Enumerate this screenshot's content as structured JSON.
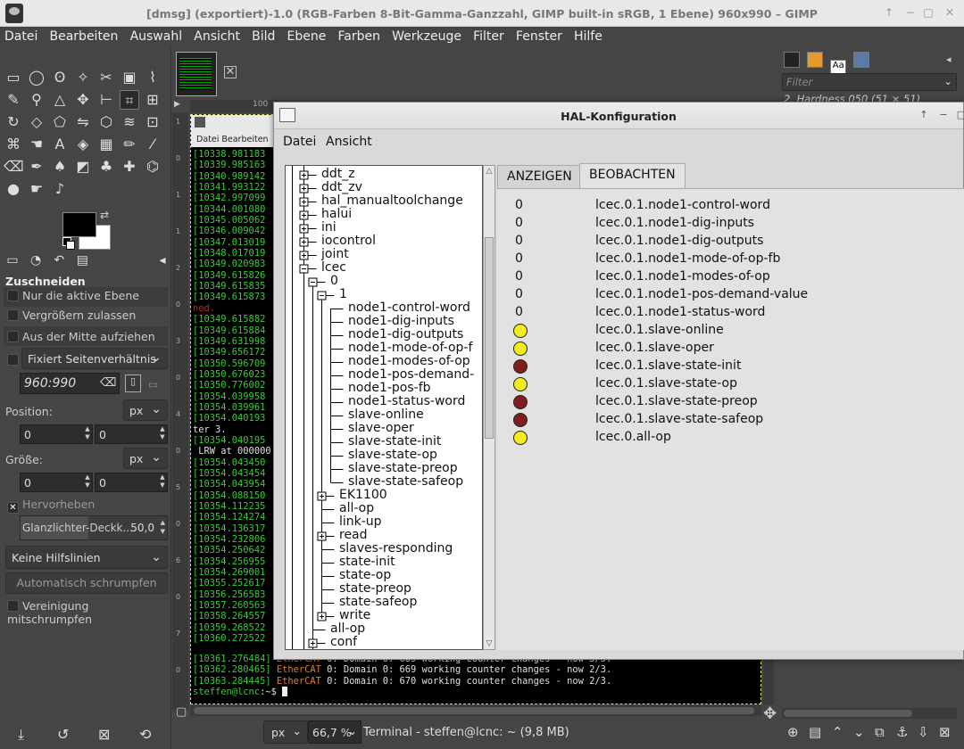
{
  "gimp": {
    "title": "[dmsg] (exportiert)-1.0 (RGB-Farben 8-Bit-Gamma-Ganzzahl, GIMP built-in sRGB, 1 Ebene) 960x990 – GIMP",
    "menu": [
      "Datei",
      "Bearbeiten",
      "Auswahl",
      "Ansicht",
      "Bild",
      "Ebene",
      "Farben",
      "Werkzeuge",
      "Filter",
      "Fenster",
      "Hilfe"
    ],
    "window_buttons": [
      "↑",
      "−",
      "□",
      "✕"
    ]
  },
  "toolbox": {
    "options_title": "Zuschneiden",
    "only_active_layer": "Nur die aktive Ebene",
    "allow_grow": "Vergrößern zulassen",
    "from_center": "Aus der Mitte aufziehen",
    "fixed_ratio": "Fixiert  Seitenverhältnis",
    "ratio_value": "960:990",
    "position_label": "Position:",
    "size_label": "Größe:",
    "unit": "px",
    "pos_x": "0",
    "pos_y": "0",
    "size_w": "0",
    "size_h": "0",
    "highlight_label": "Hervorheben",
    "highlight_opacity_label": "Glanzlichter-Deckk...",
    "highlight_opacity_value": "50,0",
    "guides": "Keine Hilfslinien",
    "auto_shrink": "Automatisch schrumpfen",
    "shrink_merged": "Vereinigung mitschrumpfen"
  },
  "image": {
    "ruler_mark": "100",
    "ruler_v": [
      "1",
      "0",
      "1",
      "1",
      "2",
      "0",
      "3",
      "0",
      "4",
      "0",
      "5",
      "0",
      "6",
      "0",
      "7",
      "0"
    ],
    "terminal_menu": "Datei   Bearbeiten",
    "terminal_lines": [
      {
        "c": "g",
        "t": "[10338.981183"
      },
      {
        "c": "g",
        "t": "[10339.985163"
      },
      {
        "c": "g",
        "t": "[10340.989142"
      },
      {
        "c": "g",
        "t": "[10341.993122"
      },
      {
        "c": "g",
        "t": "[10342.997099"
      },
      {
        "c": "g",
        "t": "[10344.001080"
      },
      {
        "c": "g",
        "t": "[10345.005062"
      },
      {
        "c": "g",
        "t": "[10346.009042"
      },
      {
        "c": "g",
        "t": "[10347.013019"
      },
      {
        "c": "g",
        "t": "[10348.017019"
      },
      {
        "c": "g",
        "t": "[10349.020983"
      },
      {
        "c": "g",
        "t": "[10349.615826"
      },
      {
        "c": "g",
        "t": "[10349.615835"
      },
      {
        "c": "g",
        "t": "[10349.615873"
      },
      {
        "c": "r",
        "t": "ned."
      },
      {
        "c": "g",
        "t": "[10349.615882"
      },
      {
        "c": "g",
        "t": "[10349.615884"
      },
      {
        "c": "g",
        "t": "[10349.631998"
      },
      {
        "c": "g",
        "t": "[10349.656172"
      },
      {
        "c": "g",
        "t": "[10350.596709"
      },
      {
        "c": "g",
        "t": "[10350.676023"
      },
      {
        "c": "g",
        "t": "[10350.776002"
      },
      {
        "c": "g",
        "t": "[10354.039958"
      },
      {
        "c": "g",
        "t": "[10354.039961"
      },
      {
        "c": "g",
        "t": "[10354.040193"
      },
      {
        "c": "w",
        "t": "ter 3."
      },
      {
        "c": "g",
        "t": "[10354.040195"
      },
      {
        "c": "w",
        "t": " LRW at 000000"
      },
      {
        "c": "g",
        "t": "[10354.043450"
      },
      {
        "c": "g",
        "t": "[10354.043454"
      },
      {
        "c": "g",
        "t": "[10354.043954"
      },
      {
        "c": "g",
        "t": "[10354.088150"
      },
      {
        "c": "g",
        "t": "[10354.112235"
      },
      {
        "c": "g",
        "t": "[10354.124274"
      },
      {
        "c": "g",
        "t": "[10354.136317"
      },
      {
        "c": "g",
        "t": "[10354.232806"
      },
      {
        "c": "g",
        "t": "[10354.250642"
      },
      {
        "c": "g",
        "t": "[10354.256955"
      },
      {
        "c": "g",
        "t": "[10354.269001"
      },
      {
        "c": "g",
        "t": "[10355.252617"
      },
      {
        "c": "g",
        "t": "[10356.256583"
      },
      {
        "c": "g",
        "t": "[10357.260563"
      },
      {
        "c": "g",
        "t": "[10358.264557"
      },
      {
        "c": "g",
        "t": "[10359.268522"
      },
      {
        "c": "g",
        "t": "[10360.272522"
      }
    ],
    "terminal_tail": [
      {
        "ts": "[10361.276484]",
        "src": " EtherCAT ",
        "n": "0",
        "msg": ": Domain 0: 669 working counter changes - now 3/3."
      },
      {
        "ts": "[10362.280465]",
        "src": " EtherCAT ",
        "n": "0",
        "msg": ": Domain 0: 669 working counter changes - now 2/3."
      },
      {
        "ts": "[10363.284445]",
        "src": " EtherCAT ",
        "n": "0",
        "msg": ": Domain 0: 670 working counter changes - now 2/3."
      }
    ],
    "prompt_user": "steffen@lcnc",
    "prompt_rest": ":~$ ",
    "status_unit": "px",
    "zoom": "66,7 %",
    "status_text": "Terminal - steffen@lcnc: ~ (9,8 MB)"
  },
  "dock": {
    "filter_placeholder": "Filter",
    "brush_name": "2. Hardness 050 (51 × 51)"
  },
  "hal": {
    "title": "HAL-Konfiguration",
    "menu": [
      "Datei",
      "Ansicht"
    ],
    "window_buttons": [
      "↑",
      "−",
      "□"
    ],
    "tabs": [
      "ANZEIGEN",
      "BEOBACHTEN"
    ],
    "active_tab": 1,
    "tree": [
      {
        "depth": 0,
        "label": "ddt_z",
        "exp": "+"
      },
      {
        "depth": 0,
        "label": "ddt_zv",
        "exp": "+"
      },
      {
        "depth": 0,
        "label": "hal_manualtoolchange",
        "exp": "+"
      },
      {
        "depth": 0,
        "label": "halui",
        "exp": "+"
      },
      {
        "depth": 0,
        "label": "ini",
        "exp": "+"
      },
      {
        "depth": 0,
        "label": "iocontrol",
        "exp": "+"
      },
      {
        "depth": 0,
        "label": "joint",
        "exp": "+"
      },
      {
        "depth": 0,
        "label": "lcec",
        "exp": "-"
      },
      {
        "depth": 1,
        "label": "0",
        "exp": "-"
      },
      {
        "depth": 2,
        "label": "1",
        "exp": "-"
      },
      {
        "depth": 3,
        "label": "node1-control-word"
      },
      {
        "depth": 3,
        "label": "node1-dig-inputs"
      },
      {
        "depth": 3,
        "label": "node1-dig-outputs"
      },
      {
        "depth": 3,
        "label": "node1-mode-of-op-f"
      },
      {
        "depth": 3,
        "label": "node1-modes-of-op"
      },
      {
        "depth": 3,
        "label": "node1-pos-demand-"
      },
      {
        "depth": 3,
        "label": "node1-pos-fb"
      },
      {
        "depth": 3,
        "label": "node1-status-word"
      },
      {
        "depth": 3,
        "label": "slave-online"
      },
      {
        "depth": 3,
        "label": "slave-oper"
      },
      {
        "depth": 3,
        "label": "slave-state-init"
      },
      {
        "depth": 3,
        "label": "slave-state-op"
      },
      {
        "depth": 3,
        "label": "slave-state-preop"
      },
      {
        "depth": 3,
        "label": "slave-state-safeop"
      },
      {
        "depth": 2,
        "label": "EK1100",
        "exp": "+"
      },
      {
        "depth": 2,
        "label": "all-op"
      },
      {
        "depth": 2,
        "label": "link-up"
      },
      {
        "depth": 2,
        "label": "read",
        "exp": "+"
      },
      {
        "depth": 2,
        "label": "slaves-responding"
      },
      {
        "depth": 2,
        "label": "state-init"
      },
      {
        "depth": 2,
        "label": "state-op"
      },
      {
        "depth": 2,
        "label": "state-preop"
      },
      {
        "depth": 2,
        "label": "state-safeop"
      },
      {
        "depth": 2,
        "label": "write",
        "exp": "+"
      },
      {
        "depth": 1,
        "label": "all-op"
      },
      {
        "depth": 1,
        "label": "conf",
        "exp": "+"
      }
    ],
    "watch": [
      {
        "value": "0",
        "name": "lcec.0.1.node1-control-word"
      },
      {
        "value": "0",
        "name": "lcec.0.1.node1-dig-inputs"
      },
      {
        "value": "0",
        "name": "lcec.0.1.node1-dig-outputs"
      },
      {
        "value": "0",
        "name": "lcec.0.1.node1-mode-of-op-fb"
      },
      {
        "value": "0",
        "name": "lcec.0.1.node1-modes-of-op"
      },
      {
        "value": "0",
        "name": "lcec.0.1.node1-pos-demand-value"
      },
      {
        "value": "0",
        "name": "lcec.0.1.node1-status-word"
      },
      {
        "led": true,
        "name": "lcec.0.1.slave-online"
      },
      {
        "led": true,
        "name": "lcec.0.1.slave-oper"
      },
      {
        "led": false,
        "name": "lcec.0.1.slave-state-init"
      },
      {
        "led": true,
        "name": "lcec.0.1.slave-state-op"
      },
      {
        "led": false,
        "name": "lcec.0.1.slave-state-preop"
      },
      {
        "led": false,
        "name": "lcec.0.1.slave-state-safeop"
      },
      {
        "led": true,
        "name": "lcec.0.all-op"
      }
    ],
    "colors": {
      "led_on": "#f2ec1a",
      "led_off": "#7d1f1f"
    }
  }
}
